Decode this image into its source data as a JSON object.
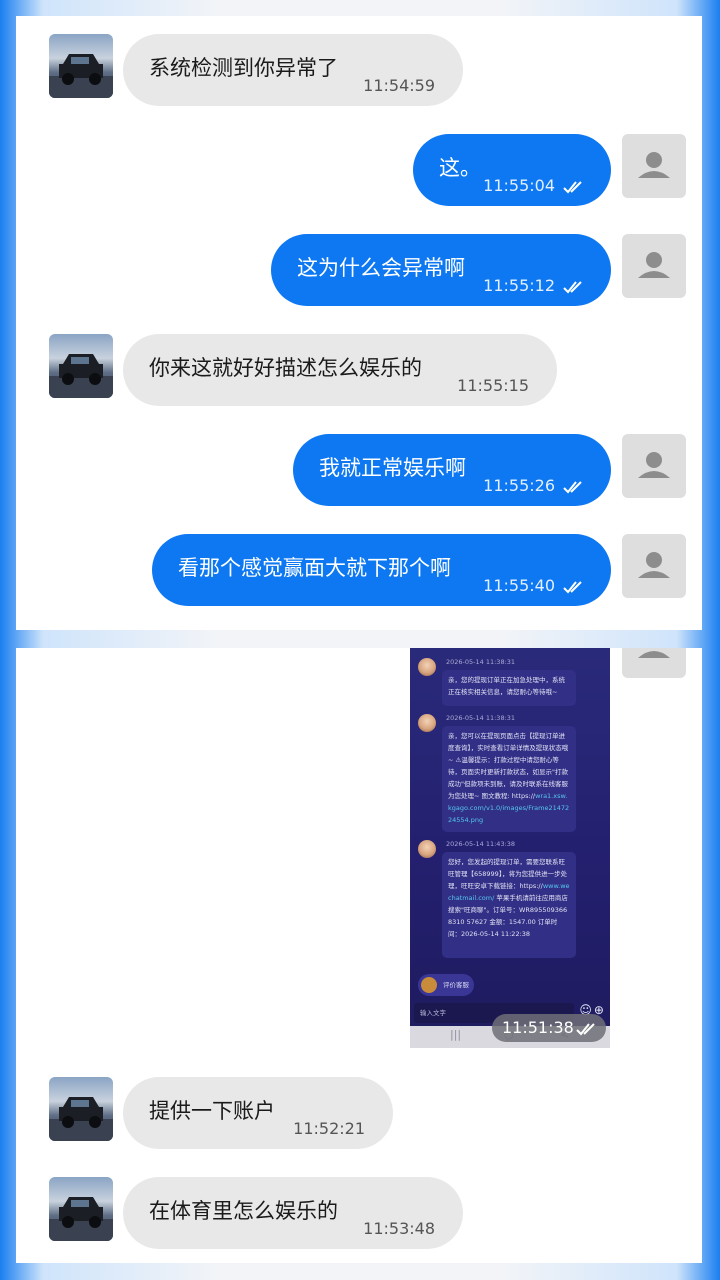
{
  "panel1": {
    "messages": [
      {
        "side": "in",
        "text": "系统检测到你异常了",
        "time": "11:54:59"
      },
      {
        "side": "out",
        "text": "这。",
        "time": "11:55:04"
      },
      {
        "side": "out",
        "text": "这为什么会异常啊",
        "time": "11:55:12"
      },
      {
        "side": "in",
        "text": "你来这就好好描述怎么娱乐的",
        "time": "11:55:15"
      },
      {
        "side": "out",
        "text": "我就正常娱乐啊",
        "time": "11:55:26"
      },
      {
        "side": "out",
        "text": "看那个感觉赢面大就下那个啊",
        "time": "11:55:40"
      }
    ]
  },
  "panel2": {
    "screenshot_time": "11:51:38",
    "screenshot": {
      "ts1": "2026-05-14 11:38:31",
      "msg1": "亲，您的提现订单正在加急处理中，系统正在核实相关信息，请您耐心等待哦~",
      "ts2": "2026-05-14 11:38:31",
      "msg2_a": "亲，您可以在提现页面点击【提现订单进度查询】，实时查看订单详情及提现状态哦~ ⚠温馨提示：打款过程中请您耐心等待，页面实时更新打款状态，如显示\"打款成功\"但款项未到账，请及时联系在线客服为您处理~ 图文教程: https://",
      "msg2_link": "wra1.xsw.kgago.com/v1.0/images/Frame2147224554.png",
      "ts3": "2026-05-14 11:43:38",
      "msg3_a": "您好，您发起的提现订单，需要您联系旺旺管理【658999】，将为您提供进一步处理，旺旺安卓下载链接：https://",
      "msg3_link": "www.wechatmail.com/",
      "msg3_b": " 苹果手机请前往应用商店搜索\"旺商聊\"。订单号：WR8955093668310 57627 金额：1547.00 订单时间：2026-05-14 11:22:38",
      "rate_label": "评价客服",
      "input_placeholder": "输入文字"
    },
    "messages": [
      {
        "side": "in",
        "text": "提供一下账户",
        "time": "11:52:21"
      },
      {
        "side": "in",
        "text": "在体育里怎么娱乐的",
        "time": "11:53:48"
      }
    ]
  },
  "colors": {
    "outgoing_bubble": "#0d78f2",
    "incoming_bubble": "#e8e8e8",
    "accent": "#1a7ff0"
  },
  "icons": {
    "user_placeholder": "person-icon",
    "read_receipt": "double-check-icon",
    "other_avatar": "car-photo-avatar"
  }
}
